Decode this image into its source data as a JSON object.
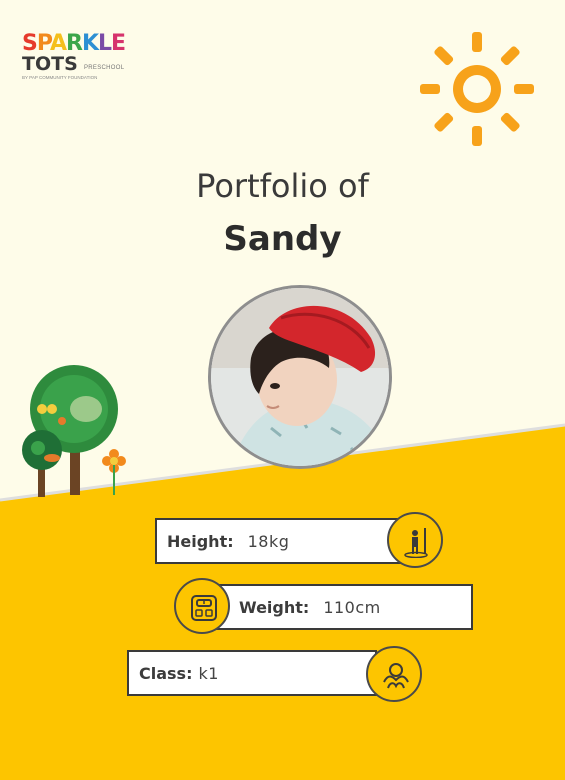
{
  "logo": {
    "line1": "SPARKLE",
    "line2": "TOTS",
    "side": "PRESCHOOL",
    "sub": "BY PAP COMMUNITY FOUNDATION"
  },
  "title": {
    "line1": "Portfolio of",
    "name": "Sandy"
  },
  "details": [
    {
      "label": "Height",
      "value": "18kg",
      "icon": "height-measure-icon"
    },
    {
      "label": "Weight",
      "value": "110cm",
      "icon": "weighing-scale-icon"
    },
    {
      "label": "Class",
      "value": "k1",
      "icon": "children-hug-icon"
    }
  ],
  "colors": {
    "background": "#fefce9",
    "accent_yellow": "#fdc500",
    "sun_orange": "#f7a21a",
    "tree_green": "#2e8b3d",
    "text_dark": "#3a3a3a"
  }
}
